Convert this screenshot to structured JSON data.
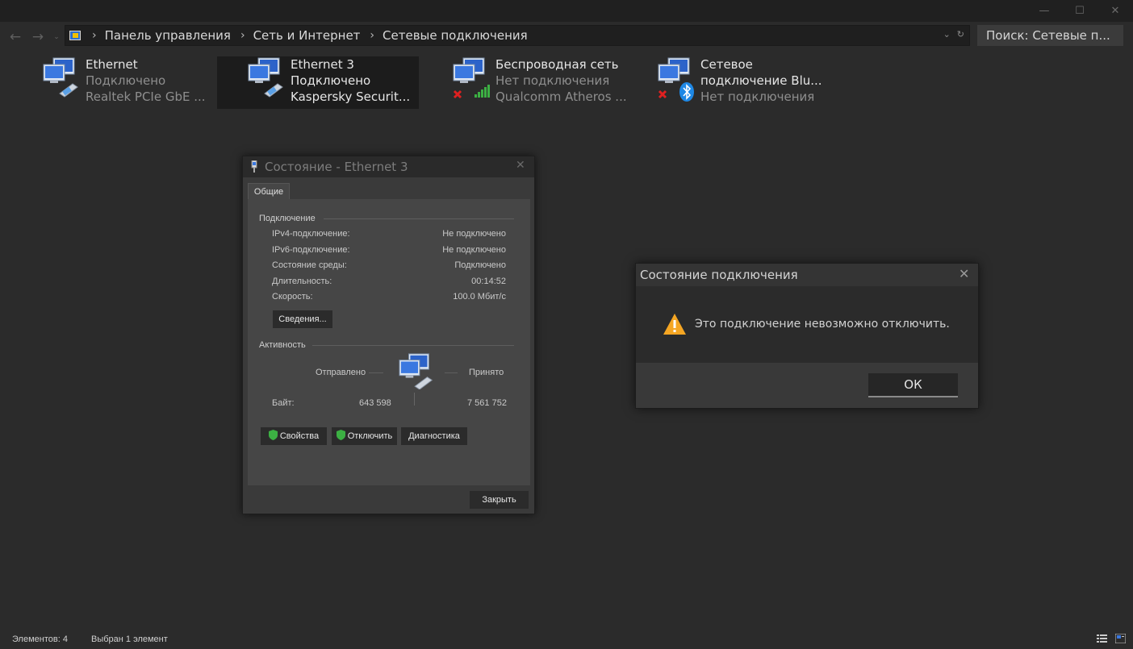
{
  "window": {
    "controls": {
      "minimize": "—",
      "maximize": "☐",
      "close": "✕"
    }
  },
  "nav": {
    "back": "←",
    "forward": "→",
    "dropdown": "⌄",
    "breadcrumb": [
      "Панель управления",
      "Сеть и Интернет",
      "Сетевые подключения"
    ],
    "separator": "›",
    "search_placeholder": "Поиск: Сетевые п..."
  },
  "connections": [
    {
      "name": "Ethernet",
      "status": "Подключено",
      "device": "Realtek PCIe GbE ...",
      "icon": "wired-network-icon",
      "selected": false
    },
    {
      "name": "Ethernet 3",
      "status": "Подключено",
      "device": "Kaspersky Securit...",
      "icon": "wired-network-icon",
      "selected": true
    },
    {
      "name": "Беспроводная сеть",
      "status": "Нет подключения",
      "device": "Qualcomm Atheros ...",
      "icon": "wireless-network-icon",
      "selected": false
    },
    {
      "name": "Сетевое",
      "name2": "подключение Blu...",
      "status": "Нет подключения",
      "icon": "bluetooth-network-icon",
      "selected": false
    }
  ],
  "status_dialog": {
    "title": "Состояние - Ethernet 3",
    "tab": "Общие",
    "connection_section": "Подключение",
    "rows": [
      {
        "label": "IPv4-подключение:",
        "value": "Не подключено"
      },
      {
        "label": "IPv6-подключение:",
        "value": "Не подключено"
      },
      {
        "label": "Состояние среды:",
        "value": "Подключено"
      },
      {
        "label": "Длительность:",
        "value": "00:14:52"
      },
      {
        "label": "Скорость:",
        "value": "100.0 Мбит/с"
      }
    ],
    "details_button": "Сведения...",
    "activity_section": "Активность",
    "sent_label": "Отправлено",
    "received_label": "Принято",
    "bytes_label": "Байт:",
    "bytes_sent": "643 598",
    "bytes_received": "7 561 752",
    "properties_button": "Свойства",
    "disable_button": "Отключить",
    "diagnose_button": "Диагностика",
    "close_button": "Закрыть"
  },
  "message_box": {
    "title": "Состояние подключения",
    "text": "Это подключение невозможно отключить.",
    "ok_button": "ОК"
  },
  "statusbar": {
    "count": "Элементов: 4",
    "selected": "Выбран 1 элемент"
  },
  "colors": {
    "background": "#2b2b2b",
    "warning": "#f5a623",
    "shield": "#3cb043",
    "error_x": "#e02020",
    "bluetooth": "#1e88e5"
  }
}
